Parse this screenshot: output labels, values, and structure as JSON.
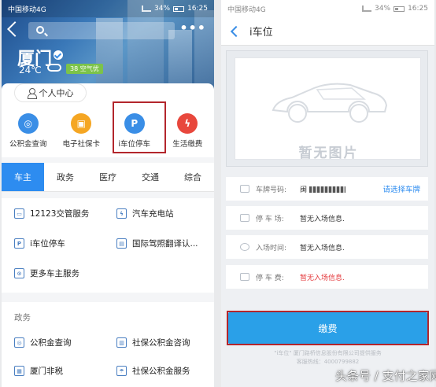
{
  "status_left": {
    "carrier": "中国移动4G",
    "battery": "34%",
    "time": "16:25"
  },
  "status_right": {
    "carrier": "中国移动4G",
    "battery": "34%",
    "time": "16:25"
  },
  "left": {
    "city": "厦门",
    "temperature": "24℃",
    "aqi": "38 空气优",
    "personal_center": "个人中心",
    "services": [
      {
        "label": "公积金查询",
        "icon": "housing-fund-icon",
        "color": "#3a8ee6"
      },
      {
        "label": "电子社保卡",
        "icon": "social-card-icon",
        "color": "#f5a623"
      },
      {
        "label": "i车位停车",
        "icon": "parking-icon",
        "color": "#3a8ee6"
      },
      {
        "label": "生活缴费",
        "icon": "utility-icon",
        "color": "#e8473c"
      }
    ],
    "tabs": [
      "车主",
      "政务",
      "医疗",
      "交通",
      "综合"
    ],
    "active_tab": "车主",
    "car_items": [
      "12123交管服务",
      "汽车充电站",
      "i车位停车",
      "国际驾照翻译认...",
      "更多车主服务"
    ],
    "gov_section_title": "政务",
    "gov_items": [
      "公积金查询",
      "社保公积金咨询",
      "厦门非税",
      "社保公积金服务"
    ]
  },
  "right": {
    "title": "i车位",
    "no_image": "暂无图片",
    "plate_label": "车牌号码:",
    "plate_value": "闽",
    "select_plate": "请选择车牌",
    "lot_label": "停 车 场:",
    "lot_value": "暂无入场信息.",
    "entry_label": "入场时间:",
    "entry_value": "暂无入场信息.",
    "fee_label": "停 车 费:",
    "fee_value": "暂无入场信息.",
    "pay_button": "缴费",
    "footnote1": "\"i车位\" 厦门路桥信息股份有限公司提供服务",
    "footnote2": "客服热线：4000799882"
  },
  "watermark": "头条号 / 支付之家网"
}
